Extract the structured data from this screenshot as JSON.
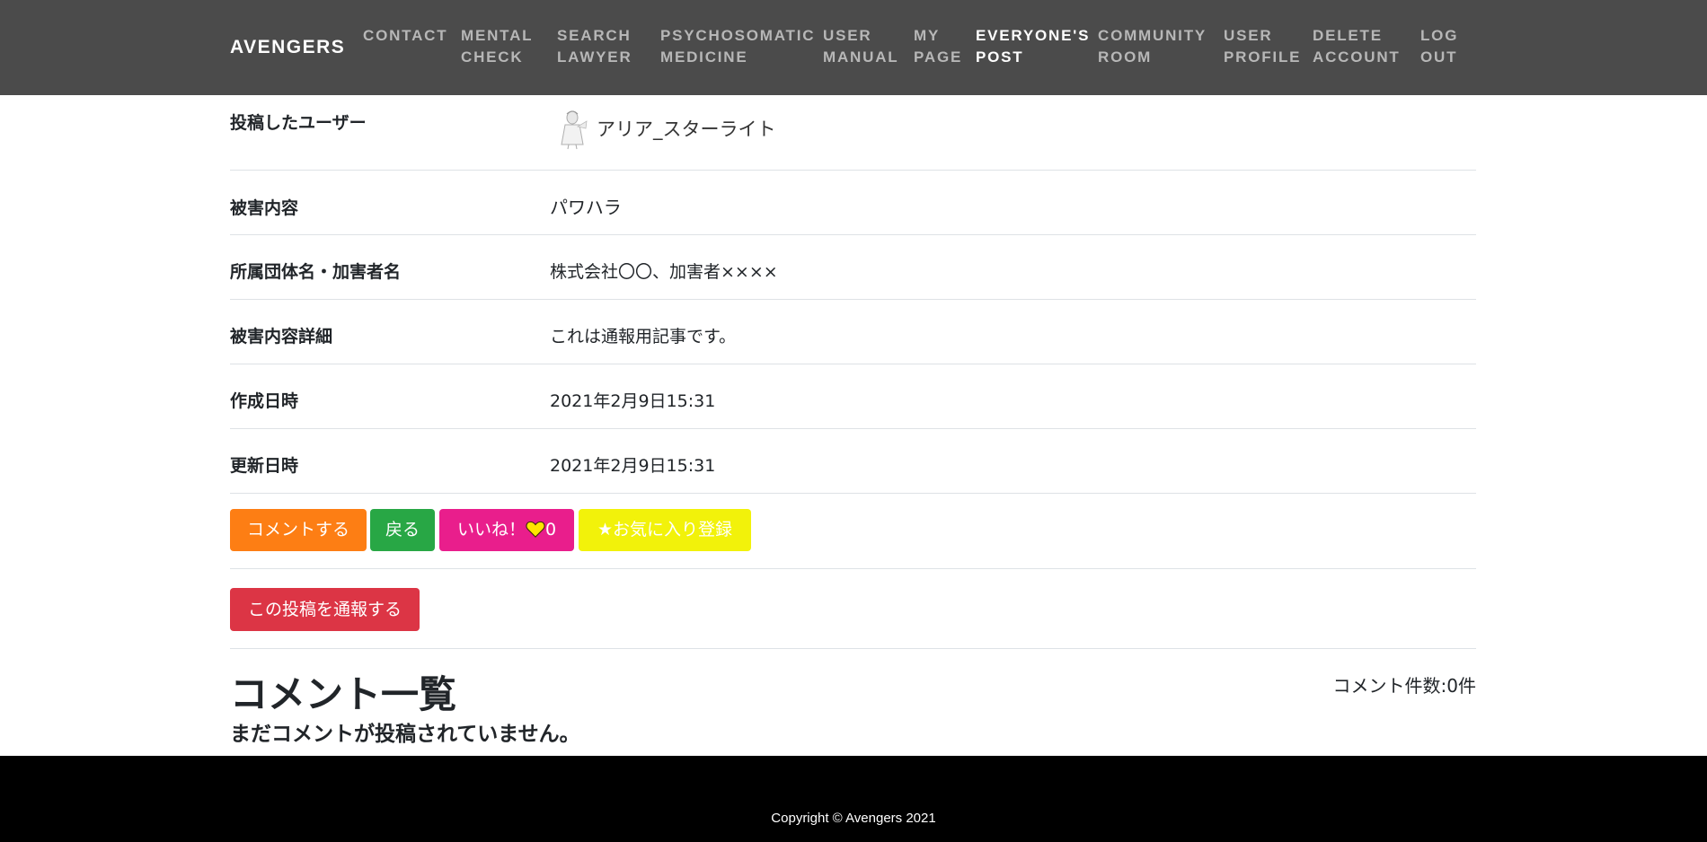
{
  "nav": {
    "brand": "AVENGERS",
    "items": [
      {
        "line1": "CONTACT",
        "line2": ""
      },
      {
        "line1": "MENTAL",
        "line2": "CHECK"
      },
      {
        "line1": "SEARCH",
        "line2": "LAWYER"
      },
      {
        "line1": "PSYCHOSOMATIC",
        "line2": "MEDICINE"
      },
      {
        "line1": "USER",
        "line2": "MANUAL"
      },
      {
        "line1": "MY",
        "line2": "PAGE"
      },
      {
        "line1": "EVERYONE'S",
        "line2": "POST"
      },
      {
        "line1": "COMMUNITY",
        "line2": "ROOM"
      },
      {
        "line1": "USER",
        "line2": "PROFILE"
      },
      {
        "line1": "DELETE",
        "line2": "ACCOUNT"
      },
      {
        "line1": "LOG",
        "line2": "OUT"
      }
    ]
  },
  "post": {
    "user_label": "投稿したユーザー",
    "user_name": "アリア_スターライト",
    "rows": [
      {
        "label": "被害内容",
        "value": "パワハラ"
      },
      {
        "label": "所属団体名・加害者名",
        "value": "株式会社〇〇、加害者××××"
      },
      {
        "label": "被害内容詳細",
        "value": "これは通報用記事です。"
      },
      {
        "label": "作成日時",
        "value": "2021年2月9日15:31"
      },
      {
        "label": "更新日時",
        "value": "2021年2月9日15:31"
      }
    ]
  },
  "actions": {
    "comment": "コメントする",
    "back": "戻る",
    "like_label": "いいね！",
    "like_count": "0",
    "favorite": "★お気に入り登録",
    "report": "この投稿を通報する"
  },
  "comments": {
    "title": "コメント一覧",
    "count": "コメント件数:0件",
    "empty": "まだコメントが投稿されていません。"
  },
  "footer": {
    "copyright": "Copyright © Avengers 2021"
  },
  "colors": {
    "navbar": "#4b4b4b",
    "comment_button": "#fd7e14",
    "back_button": "#28a745",
    "like_button": "#e91e8c",
    "favorite_button": "#f2f20a",
    "report_button": "#dc3545",
    "heart": "#ffe500"
  }
}
